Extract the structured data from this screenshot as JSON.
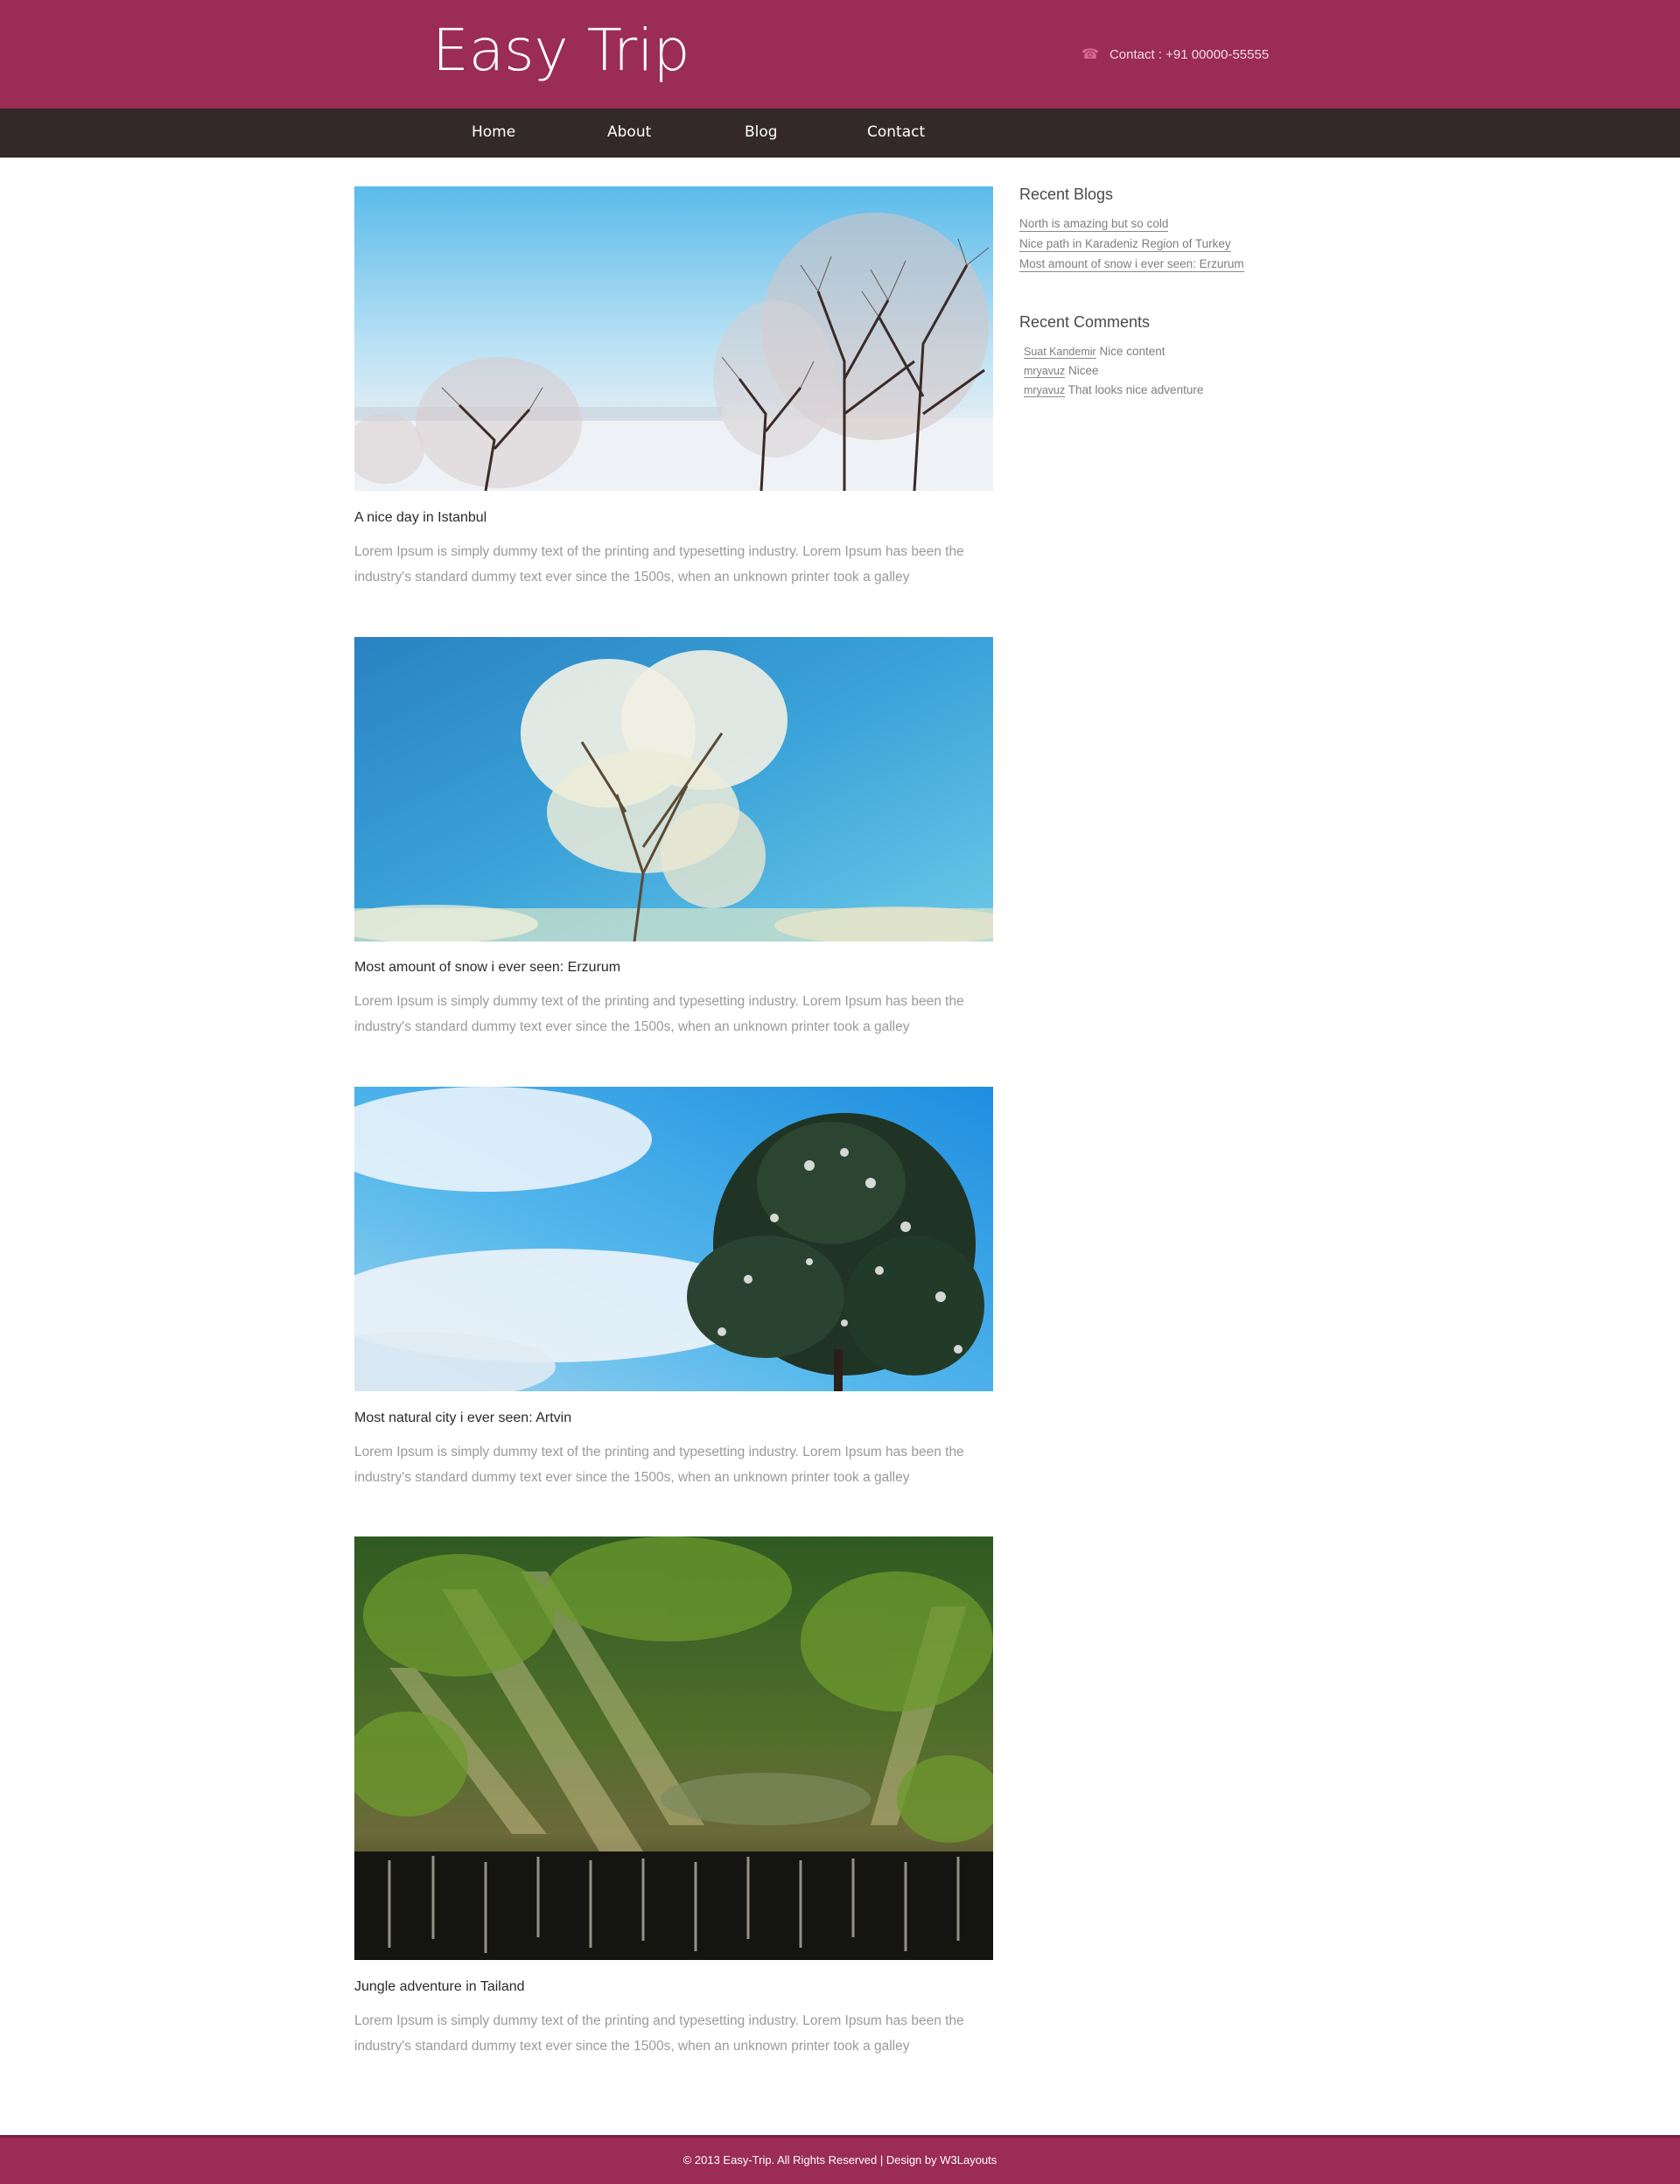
{
  "header": {
    "logo": "Easy Trip",
    "contact_icon": "phone-icon",
    "contact": "Contact : +91 00000-55555"
  },
  "nav": {
    "items": [
      {
        "label": "Home"
      },
      {
        "label": "About"
      },
      {
        "label": "Blog"
      },
      {
        "label": "Contact"
      }
    ]
  },
  "posts": [
    {
      "title": "A nice day in Istanbul",
      "text": "Lorem Ipsum is simply dummy text of the printing and typesetting industry. Lorem Ipsum has been the industry's standard dummy text ever since the 1500s, when an unknown printer took a galley",
      "image": "frosted trees in a snowy field under a pale blue sky"
    },
    {
      "title": "Most amount of snow i ever seen: Erzurum",
      "text": "Lorem Ipsum is simply dummy text of the printing and typesetting industry. Lorem Ipsum has been the industry's standard dummy text ever since the 1500s, when an unknown printer took a galley",
      "image": "frost-covered tree against a bright blue sky"
    },
    {
      "title": "Most natural city i ever seen: Artvin",
      "text": "Lorem Ipsum is simply dummy text of the printing and typesetting industry. Lorem Ipsum has been the industry's standard dummy text ever since the 1500s, when an unknown printer took a galley",
      "image": "snow-dusted evergreen tree under blue sky with clouds"
    },
    {
      "title": "Jungle adventure in Tailand",
      "text": "Lorem Ipsum is simply dummy text of the printing and typesetting industry. Lorem Ipsum has been the industry's standard dummy text ever since the 1500s, when an unknown printer took a galley",
      "image": "sunbeams through a jungle above a waterfall"
    }
  ],
  "sidebar": {
    "recent_blogs": {
      "heading": "Recent Blogs",
      "links": [
        "North is amazing but so cold",
        "Nice path in Karadeniz Region of Turkey",
        "Most amount of snow i ever seen: Erzurum"
      ]
    },
    "recent_comments": {
      "heading": "Recent Comments",
      "items": [
        {
          "author": "Suat Kandemir",
          "text": "Nice content"
        },
        {
          "author": "mryavuz",
          "text": "Nicee"
        },
        {
          "author": "mryavuz",
          "text": "That looks nice adventure"
        }
      ]
    }
  },
  "footer": {
    "text": "© 2013 Easy-Trip. All Rights Reserved | Design by W3Layouts"
  },
  "colors": {
    "brand": "#9b2c54",
    "nav_bg": "#33292a",
    "body_text": "#9a9a9a"
  }
}
